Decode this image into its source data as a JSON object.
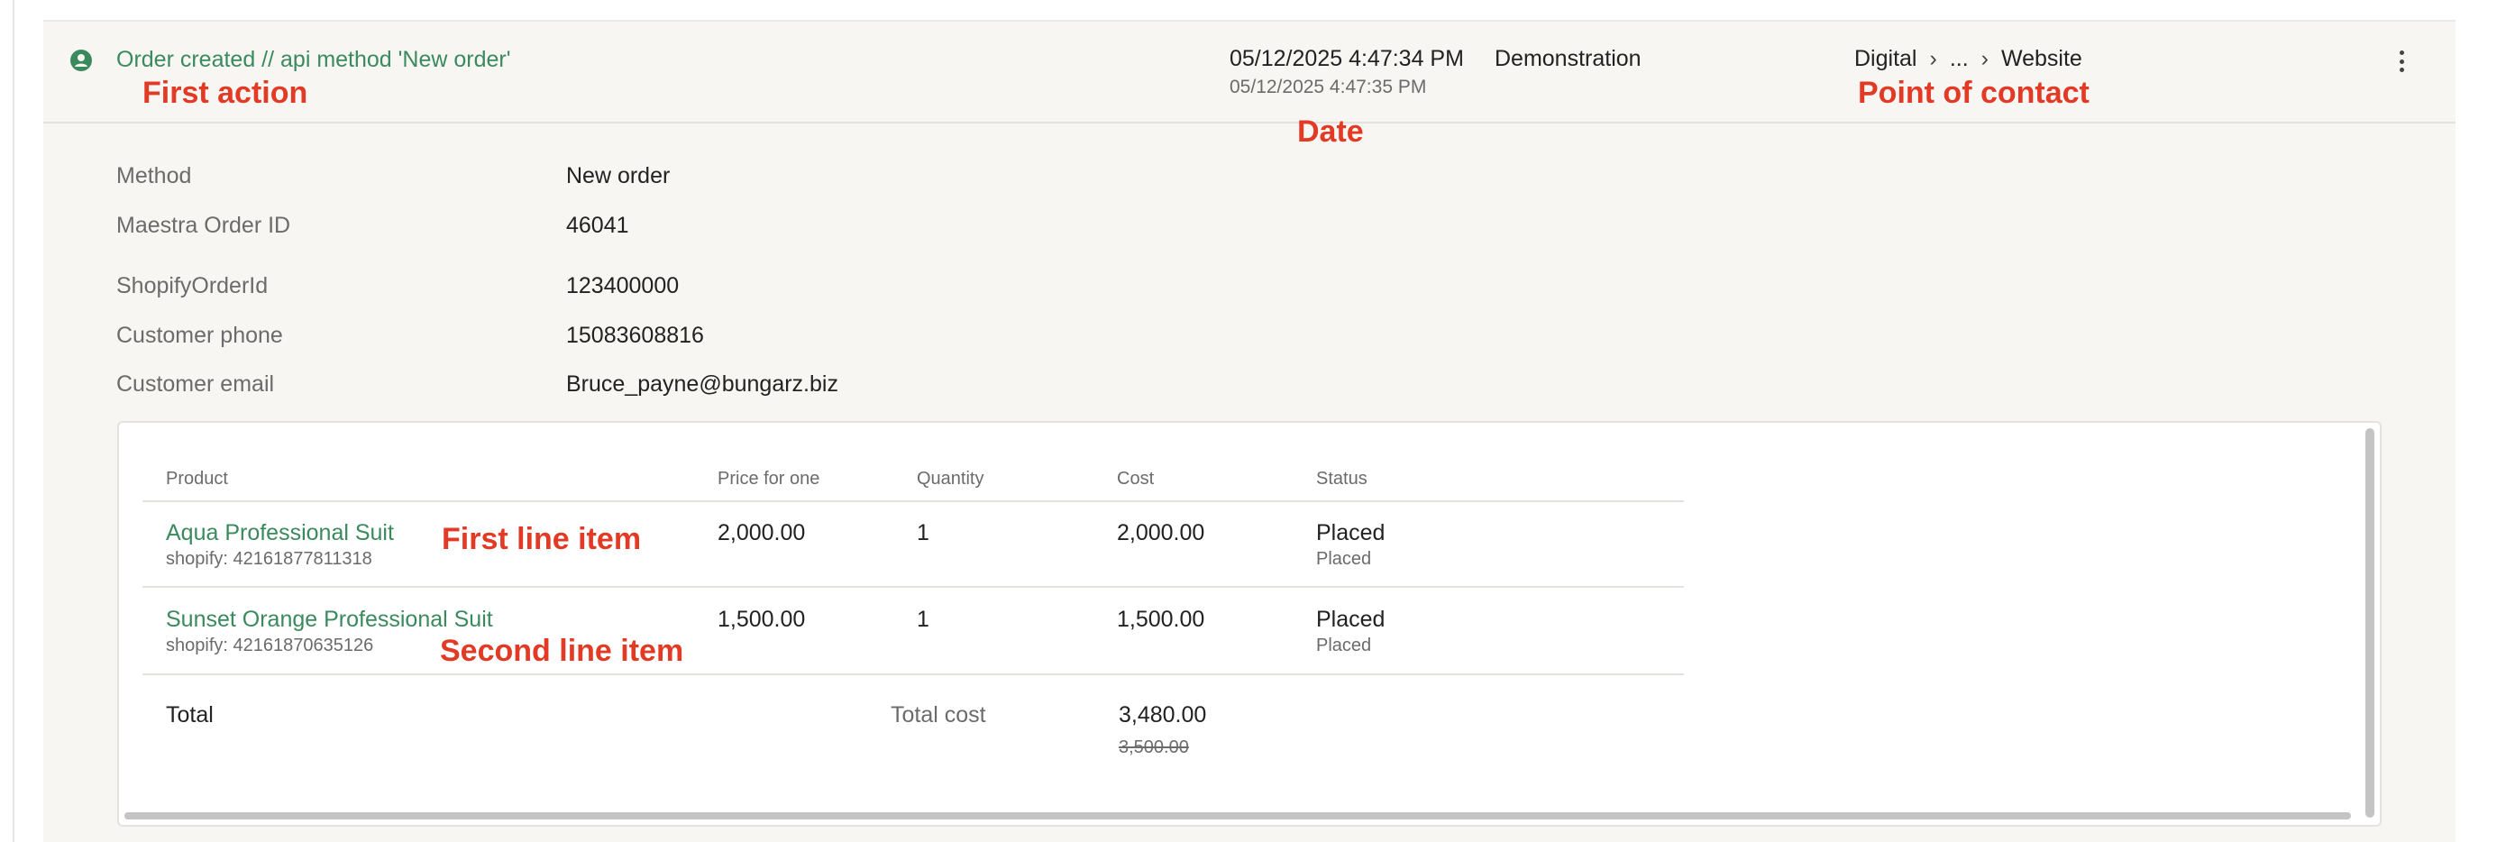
{
  "event": {
    "title": "Order created // api method 'New order'",
    "date": "05/12/2025 4:47:34 PM",
    "date_secondary": "05/12/2025 4:47:35 PM",
    "source": "Demonstration",
    "contact_path": [
      "Digital",
      "...",
      "Website"
    ],
    "contact_separator": "›",
    "accent_color": "#3a8a5e"
  },
  "annotations": {
    "first_action": "First action",
    "date": "Date",
    "point_of_contact": "Point of contact",
    "first_line_item": "First line item",
    "second_line_item": "Second line item",
    "color": "#e23a24"
  },
  "fields": [
    {
      "label": "Method",
      "value": "New order",
      "link": true
    },
    {
      "label": "Maestra Order ID",
      "value": "46041"
    },
    {
      "label": "ShopifyOrderId",
      "value": "123400000"
    },
    {
      "label": "Customer phone",
      "value": "15083608816"
    },
    {
      "label": "Customer email",
      "value": "Bruce_payne@bungarz.biz"
    }
  ],
  "table": {
    "columns": [
      "Product",
      "Price for one",
      "Quantity",
      "Cost",
      "Status"
    ],
    "rows": [
      {
        "product": "Aqua Professional Suit",
        "product_id": "shopify: 42161877811318",
        "price": "2,000.00",
        "quantity": "1",
        "cost": "2,000.00",
        "status": "Placed",
        "status_sub": "Placed"
      },
      {
        "product": "Sunset Orange Professional Suit",
        "product_id": "shopify: 42161870635126",
        "price": "1,500.00",
        "quantity": "1",
        "cost": "1,500.00",
        "status": "Placed",
        "status_sub": "Placed"
      }
    ],
    "total_label": "Total",
    "total_cost_label": "Total cost",
    "total_cost": "3,480.00",
    "total_cost_original": "3,500.00"
  }
}
